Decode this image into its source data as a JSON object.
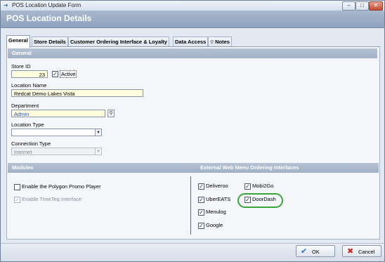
{
  "window": {
    "title": "POS Location Update Form",
    "controls": {
      "minimize": "–",
      "maximize": "□",
      "close": "✕"
    }
  },
  "page": {
    "title": "POS Location Details"
  },
  "tabs": [
    {
      "label": "General",
      "active": true
    },
    {
      "label": "Store Details",
      "active": false
    },
    {
      "label": "Customer Ordering Interface & Loyalty",
      "active": false
    },
    {
      "label": "Data Access",
      "active": false
    },
    {
      "label": "Notes",
      "active": false,
      "icon": "search-icon"
    }
  ],
  "general": {
    "section_title": "General",
    "store_id": {
      "label": "Store ID",
      "value": "23"
    },
    "active": {
      "label": "Active",
      "checked": true
    },
    "location_name": {
      "label": "Location Name",
      "value": "Redcat Demo Lakes Vista"
    },
    "department": {
      "label": "Department",
      "value": "Admin"
    },
    "location_type": {
      "label": "Location Type",
      "value": ""
    },
    "connection_type": {
      "label": "Connection Type",
      "value": "Internet"
    }
  },
  "modules": {
    "section_title": "Modules",
    "items": [
      {
        "label": "Enable the Polygon Promo Player",
        "checked": false,
        "enabled": true
      },
      {
        "label": "Enable TimeTeq Interface",
        "checked": true,
        "enabled": false
      }
    ]
  },
  "external": {
    "section_title": "External Web Menu Ordering Interfaces",
    "items": [
      {
        "label": "Deliveroo",
        "checked": true
      },
      {
        "label": "Mobi2Go",
        "checked": true
      },
      {
        "label": "UberEATS",
        "checked": true
      },
      {
        "label": "DoorDash",
        "checked": true
      },
      {
        "label": "Menulog",
        "checked": true
      },
      {
        "label": "Google",
        "checked": true
      }
    ],
    "highlight_color": "#3aa63a"
  },
  "footer": {
    "ok_label": "OK",
    "cancel_label": "Cancel",
    "ok_color": "#2a6fc9",
    "cancel_color": "#c62828"
  }
}
